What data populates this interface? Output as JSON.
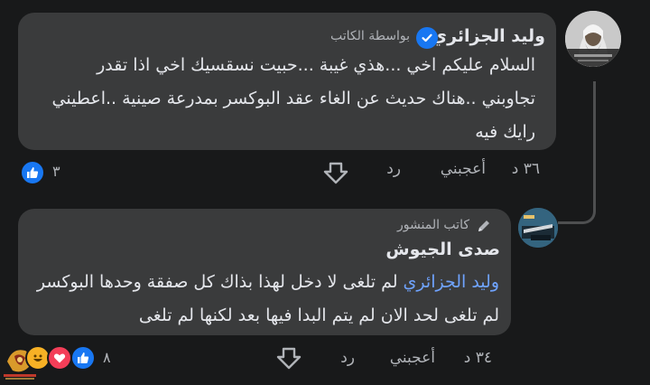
{
  "comment1": {
    "author": "وليد الجزائري",
    "author_badge": "بواسطة الكاتب",
    "lines": [
      "السلام عليكم اخي ...هذي غيبة ...حبيت نسقسيك اخي اذا تقدر",
      "تجاوبني ..هناك حديث عن الغاء عقد البوكسر بمدرعة صينية ..اعطيني",
      "رايك فيه"
    ],
    "time": "٣٦ د",
    "like_label": "أعجبني",
    "reply_label": "رد",
    "reaction_count": "٣",
    "colors": {
      "verified": "#1877f2",
      "like": "#1877f2"
    }
  },
  "reply1": {
    "author_badge": "كاتب المنشور",
    "author": "صدى الجيوش",
    "mention": "وليد الجزائري",
    "line1_rest": " لم تلغى لا دخل لهذا بذاك كل صفقة وحدها البوكسر",
    "line2": "لم تلغى لحد الان لم يتم البدا فيها بعد لكنها لم تلغى",
    "time": "٣٤ د",
    "like_label": "أعجبني",
    "reply_label": "رد",
    "reaction_count": "٨",
    "colors": {
      "love": "#f33e58",
      "haha": "#f7b125",
      "mention": "#6fa3ff"
    }
  }
}
